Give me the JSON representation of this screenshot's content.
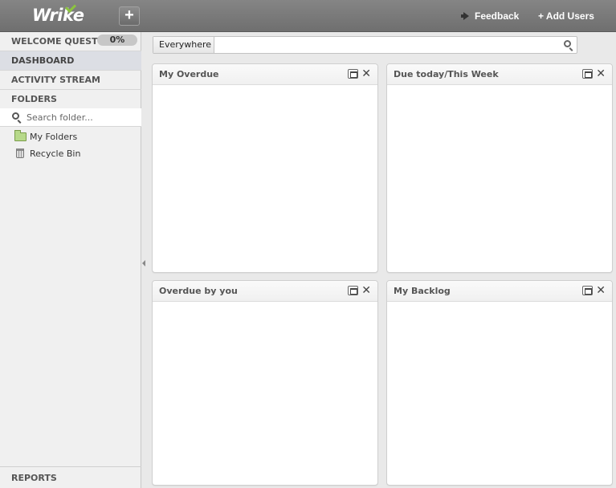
{
  "app": {
    "logo_text": "Wrike",
    "add_button_label": "+",
    "feedback_label": "Feedback",
    "add_users_label": "+ Add Users"
  },
  "sidebar": {
    "welcome_quest": {
      "label": "WELCOME QUEST",
      "progress": "0%"
    },
    "dashboard": "DASHBOARD",
    "activity_stream": "ACTIVITY STREAM",
    "folders": "FOLDERS",
    "folder_search_placeholder": "Search folder...",
    "tree": [
      {
        "label": "My Folders",
        "icon": "folder-icon"
      },
      {
        "label": "Recycle Bin",
        "icon": "recycle-bin-icon"
      }
    ],
    "reports": "REPORTS"
  },
  "search": {
    "scope": "Everywhere",
    "placeholder": ""
  },
  "widgets": [
    {
      "title": "My Overdue"
    },
    {
      "title": "Due today/This Week"
    },
    {
      "title": "Overdue by you"
    },
    {
      "title": "My Backlog"
    }
  ],
  "colors": {
    "topbar": "#7c7c7c",
    "sidebar_bg": "#f0f0f0",
    "active_item": "#dcdee4",
    "logo_check": "#8cc43f"
  }
}
